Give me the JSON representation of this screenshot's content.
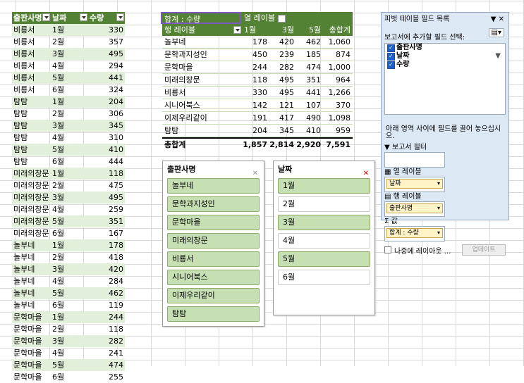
{
  "source": {
    "headers": [
      "출판사명",
      "날짜",
      "수량"
    ],
    "rows": [
      [
        "비룡서",
        "1월",
        "330"
      ],
      [
        "비룡서",
        "2월",
        "357"
      ],
      [
        "비룡서",
        "3월",
        "495"
      ],
      [
        "비룡서",
        "4월",
        "294"
      ],
      [
        "비룡서",
        "5월",
        "441"
      ],
      [
        "비룡서",
        "6월",
        "324"
      ],
      [
        "탐탐",
        "1월",
        "204"
      ],
      [
        "탐탐",
        "2월",
        "306"
      ],
      [
        "탐탐",
        "3월",
        "345"
      ],
      [
        "탐탐",
        "4월",
        "310"
      ],
      [
        "탐탐",
        "5월",
        "410"
      ],
      [
        "탐탐",
        "6월",
        "444"
      ],
      [
        "미래의창문",
        "1월",
        "118"
      ],
      [
        "미래의창문",
        "2월",
        "475"
      ],
      [
        "미래의창문",
        "3월",
        "495"
      ],
      [
        "미래의창문",
        "4월",
        "259"
      ],
      [
        "미래의창문",
        "5월",
        "351"
      ],
      [
        "미래의창문",
        "6월",
        "167"
      ],
      [
        "놀부네",
        "1월",
        "178"
      ],
      [
        "놀부네",
        "2월",
        "418"
      ],
      [
        "놀부네",
        "3월",
        "420"
      ],
      [
        "놀부네",
        "4월",
        "284"
      ],
      [
        "놀부네",
        "5월",
        "462"
      ],
      [
        "놀부네",
        "6월",
        "119"
      ],
      [
        "문학마을",
        "1월",
        "244"
      ],
      [
        "문학마을",
        "2월",
        "118"
      ],
      [
        "문학마을",
        "3월",
        "282"
      ],
      [
        "문학마을",
        "4월",
        "241"
      ],
      [
        "문학마을",
        "5월",
        "474"
      ],
      [
        "문학마을",
        "6월",
        "255"
      ]
    ]
  },
  "pivot": {
    "sum_label": "합계 : 수량",
    "col_label": "열 레이블",
    "row_label": "행 레이블",
    "columns": [
      "1월",
      "3월",
      "5월",
      "총합계"
    ],
    "rows": [
      [
        "놀부네",
        "178",
        "420",
        "462",
        "1,060"
      ],
      [
        "문학과지성인",
        "450",
        "239",
        "185",
        "874"
      ],
      [
        "문학마을",
        "244",
        "282",
        "474",
        "1,000"
      ],
      [
        "미래의창문",
        "118",
        "495",
        "351",
        "964"
      ],
      [
        "비룡서",
        "330",
        "495",
        "441",
        "1,266"
      ],
      [
        "시니어북스",
        "142",
        "121",
        "107",
        "370"
      ],
      [
        "이제우리같이",
        "191",
        "417",
        "490",
        "1,098"
      ],
      [
        "탐탐",
        "204",
        "345",
        "410",
        "959"
      ]
    ],
    "grand": [
      "총합계",
      "1,857",
      "2,814",
      "2,920",
      "7,591"
    ]
  },
  "slicer_publisher": {
    "title": "출판사명",
    "items": [
      {
        "label": "놀부네",
        "selected": true
      },
      {
        "label": "문학과지성인",
        "selected": true
      },
      {
        "label": "문학마을",
        "selected": true
      },
      {
        "label": "미래의창문",
        "selected": true
      },
      {
        "label": "비룡서",
        "selected": true
      },
      {
        "label": "시니어북스",
        "selected": true
      },
      {
        "label": "이제우리같이",
        "selected": true
      },
      {
        "label": "탐탐",
        "selected": true
      }
    ]
  },
  "slicer_date": {
    "title": "날짜",
    "items": [
      {
        "label": "1월",
        "selected": true
      },
      {
        "label": "2월",
        "selected": false
      },
      {
        "label": "3월",
        "selected": true
      },
      {
        "label": "4월",
        "selected": false
      },
      {
        "label": "5월",
        "selected": true
      },
      {
        "label": "6월",
        "selected": false
      }
    ]
  },
  "field_list": {
    "title": "피벗 테이블 필드 목록",
    "choose": "보고서에 추가할 필드 선택:",
    "fields": [
      "출판사명",
      "날짜",
      "수량"
    ],
    "instruction": "아래 영역 사이에 필드를 끌어 놓으십시오.",
    "zone_filter": "보고서 필터",
    "zone_cols": "열 레이블",
    "zone_rows": "행 레이블",
    "zone_values": "값",
    "col_chip": "날짜",
    "row_chip": "출판사명",
    "val_chip": "합계 : 수량",
    "defer": "나중에 레이아웃 ...",
    "update": "업데이트"
  },
  "colors": {
    "header_green": "#548235",
    "band": "#e2efda",
    "slicer_sel": "#c6e0b4"
  }
}
